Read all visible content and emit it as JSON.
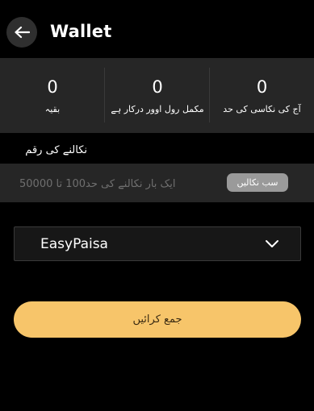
{
  "header": {
    "back_icon": "arrow-left-icon",
    "title": "Wallet"
  },
  "stats": [
    {
      "value": "0",
      "label": "بقیہ"
    },
    {
      "value": "0",
      "label": "مکمل رول اوور درکار ہے"
    },
    {
      "value": "0",
      "label": "آج کی نکاسی کی حد"
    }
  ],
  "withdraw": {
    "section_label": "نکالنے کی رقم",
    "amount_placeholder": "ایک بار نکالنے کی حد100 تا 50000",
    "withdraw_all_label": "سب نکالیں"
  },
  "payment_method": {
    "selected": "EasyPaisa",
    "icon": "chevron-down-icon"
  },
  "submit_label": "جمع کرائیں",
  "colors": {
    "background": "#000000",
    "panel": "#262626",
    "accent": "#f7c56a"
  }
}
